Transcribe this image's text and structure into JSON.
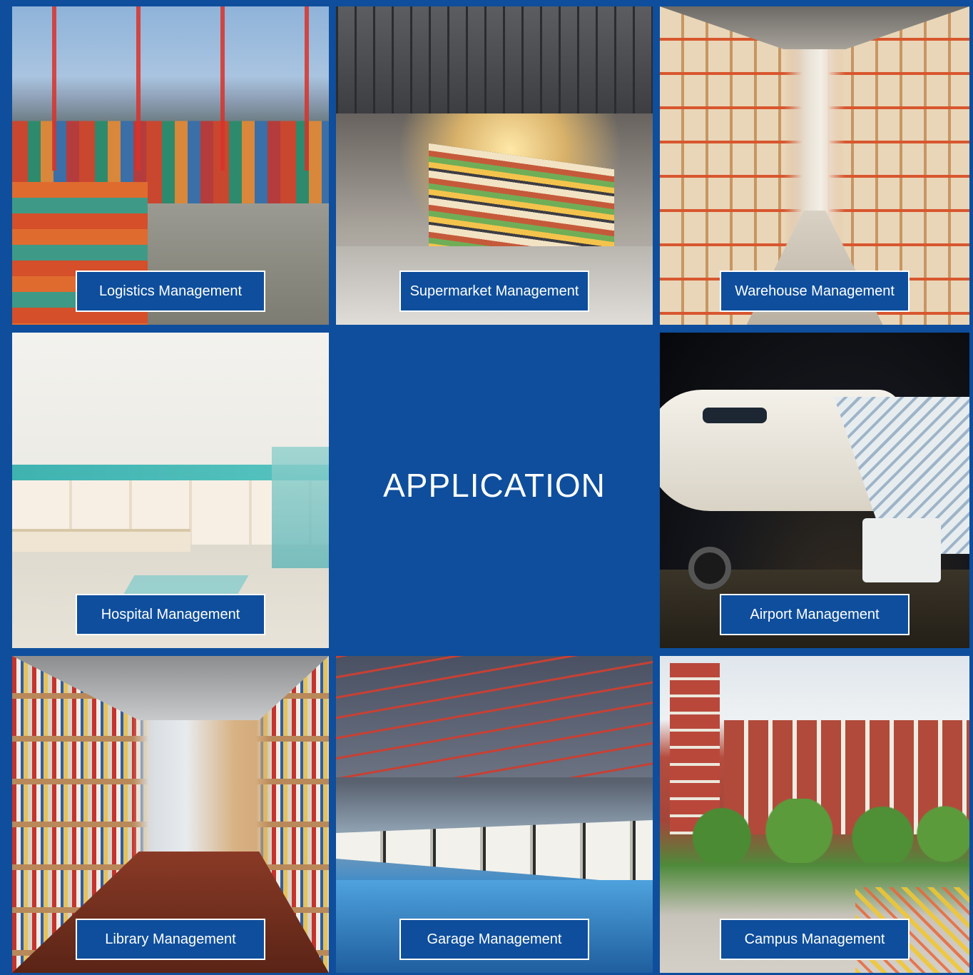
{
  "page": {
    "center_title": "APPLICATION",
    "accent_color": "#0e4e9c",
    "label_text_color": "#ffffff"
  },
  "tiles": [
    {
      "id": "logistics",
      "label": "Logistics Management"
    },
    {
      "id": "supermarket",
      "label": "Supermarket Management"
    },
    {
      "id": "warehouse",
      "label": "Warehouse Management"
    },
    {
      "id": "hospital",
      "label": "Hospital Management"
    },
    {
      "id": "airport",
      "label": "Airport Management"
    },
    {
      "id": "library",
      "label": "Library Management"
    },
    {
      "id": "garage",
      "label": "Garage Management"
    },
    {
      "id": "campus",
      "label": "Campus Management"
    }
  ]
}
